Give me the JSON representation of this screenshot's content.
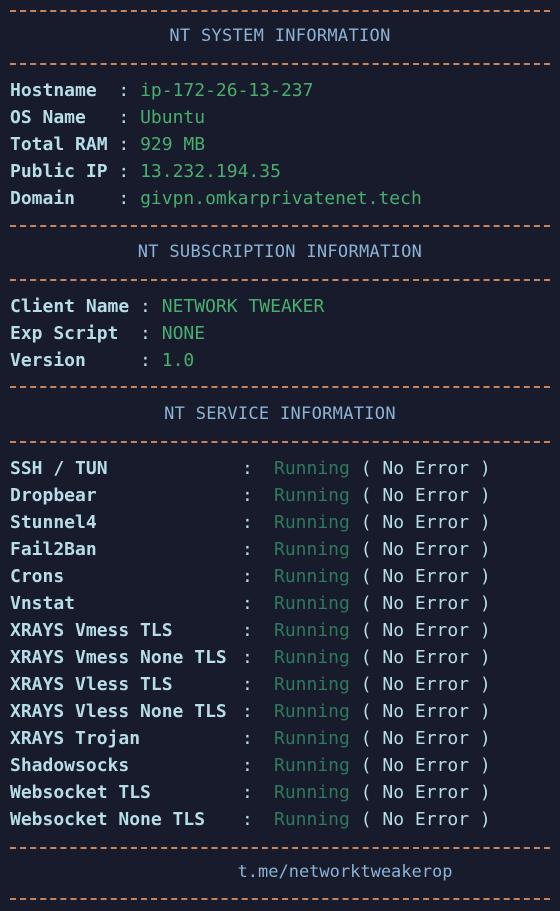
{
  "system": {
    "title": "NT SYSTEM INFORMATION",
    "rows": [
      {
        "key": "Hostname  ",
        "value": "ip-172-26-13-237"
      },
      {
        "key": "OS Name   ",
        "value": "Ubuntu"
      },
      {
        "key": "Total RAM ",
        "value": "929 MB"
      },
      {
        "key": "Public IP ",
        "value": "13.232.194.35"
      },
      {
        "key": "Domain    ",
        "value": "givpn.omkarprivatenet.tech"
      }
    ]
  },
  "subscription": {
    "title": "NT SUBSCRIPTION INFORMATION",
    "rows": [
      {
        "key": "Client Name ",
        "value": "NETWORK TWEAKER"
      },
      {
        "key": "Exp Script  ",
        "value": "NONE"
      },
      {
        "key": "Version     ",
        "value": "1.0"
      }
    ]
  },
  "services": {
    "title": "NT SERVICE INFORMATION",
    "status_word": "Running",
    "status_detail": "No Error",
    "items": [
      "SSH / TUN",
      "Dropbear",
      "Stunnel4",
      "Fail2Ban",
      "Crons",
      "Vnstat",
      "XRAYS Vmess TLS",
      "XRAYS Vmess None TLS",
      "XRAYS Vless TLS",
      "XRAYS Vless None TLS",
      "XRAYS Trojan",
      "Shadowsocks",
      "Websocket TLS",
      "Websocket None TLS"
    ]
  },
  "footer": {
    "link": "t.me/networktweakerop"
  },
  "colors": {
    "background": "#171b2b",
    "dash": "#c8845a",
    "title": "#8cb3d6",
    "key": "#b6dde8",
    "value": "#49ae6e",
    "running": "#2f7a5d"
  }
}
